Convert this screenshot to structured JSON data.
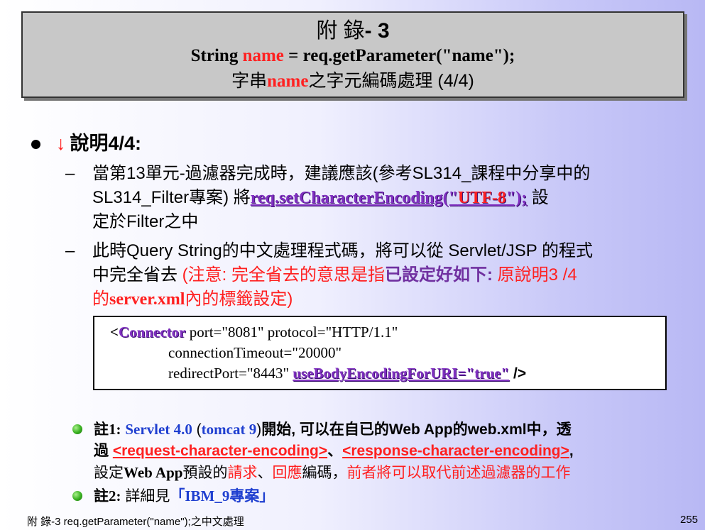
{
  "title": {
    "line1_pre": "附 錄",
    "line1_post": "- 3",
    "line2_a": "String ",
    "line2_name": "name",
    "line2_b": " = req.getParameter(\"name\");",
    "line3_a": "字串",
    "line3_name": "name",
    "line3_b": "之字元編碼處理 (4/4)"
  },
  "bullet": {
    "arrow": "↓",
    "label": "說明4/4:"
  },
  "item1": {
    "dash": "–",
    "line1": "當第13單元-過濾器完成時，建議應該(參考SL314_課程中分享中的",
    "line2_a": "SL314_Filter專案) 將",
    "code_a": "req.setCharacterEncoding(\"",
    "code_utf": "UTF-8",
    "code_b": "\");",
    "line2_b": " 設",
    "line3": "定於Filter之中"
  },
  "item2": {
    "dash": "–",
    "line1": "此時Query String的中文處理程式碼，將可以從 Servlet/JSP 的程式",
    "line2_a": "中完全省去 ",
    "line2_red": "(注意: 完全省去的意思是指",
    "line2_purple": "已設定好如下:",
    "line2_red2": " 原說明3 /4",
    "line3_red": "的",
    "line3_bold": "server.xml",
    "line3_red2": "內的標籤設定)"
  },
  "code": {
    "lt": "<",
    "tag": "Connector",
    "l1_rest": " port=\"8081\" protocol=\"HTTP/1.1\"",
    "l2": "connectionTimeout=\"20000\"",
    "l3_a": "redirectPort=\"8443\" ",
    "l3_attr": "useBodyEncodingForURI=\"true\"",
    "l3_end": " />"
  },
  "note1": {
    "label": "註1:",
    "servlet": "Servlet 4.0",
    "paren_open": " (",
    "tomcat": "tomcat 9",
    "paren_close": ")",
    "text1": "開始, 可以在自已的",
    "webapp": "Web App",
    "text2": "的",
    "webxml": "web.xml",
    "text3": "中，透",
    "text4": "過 ",
    "tag_req": "<request-character-encoding>",
    "sep": "、",
    "tag_resp": "<response-character-encoding>",
    "comma": ",",
    "text5": "設定",
    "webapp2": "Web App",
    "text6": "預設的",
    "req": "請求",
    "sep2": "、",
    "resp": "回應",
    "text7": "編碼，",
    "text8": "前者將可以取代前述過濾器的工作"
  },
  "note2": {
    "label": "註2:",
    "text": " 詳細見",
    "ref": "「IBM_9專案」"
  },
  "footer": {
    "left": "附 錄-3  req.getParameter(\"name\");之中文處理",
    "page": "255"
  },
  "colors": {
    "accent_red": "#ff2020",
    "purple": "#8030c0",
    "blue": "#1f3fd0",
    "bullet_green": "#38b020"
  }
}
